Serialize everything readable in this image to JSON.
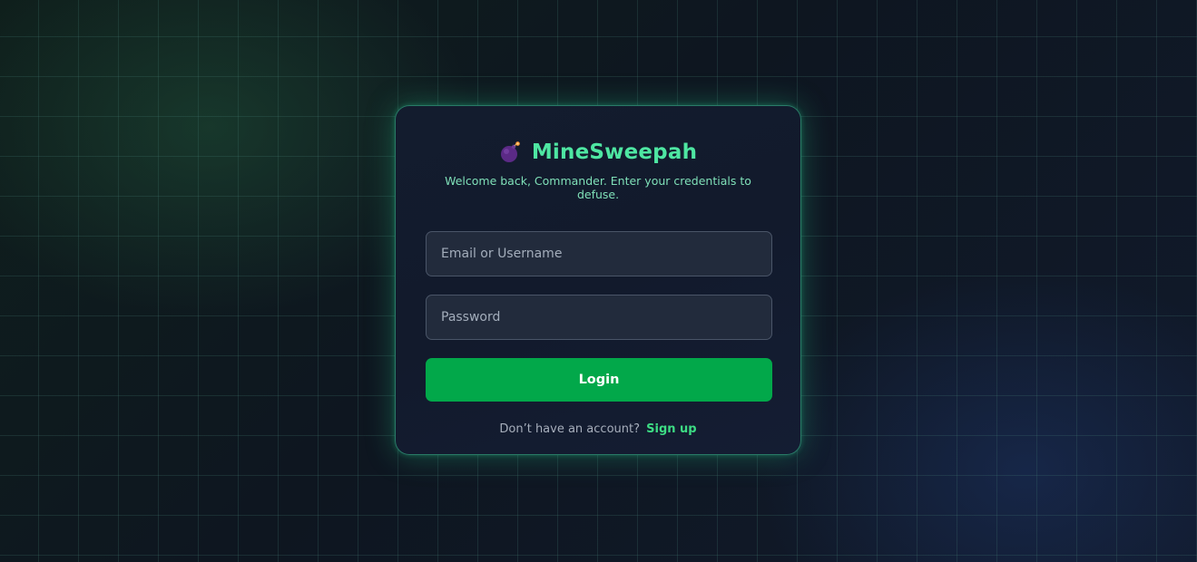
{
  "app": {
    "title": "MineSweepah",
    "logo_icon": "bomb-icon",
    "subtitle": "Welcome back, Commander. Enter your credentials to defuse."
  },
  "form": {
    "username": {
      "placeholder": "Email or Username",
      "value": ""
    },
    "password": {
      "placeholder": "Password",
      "value": ""
    },
    "login_label": "Login"
  },
  "footer": {
    "prompt": "Don’t have an account?",
    "signup_label": "Sign up"
  },
  "colors": {
    "accent": "#4ee6a2",
    "button": "#02a84a",
    "link": "#3ddc84",
    "card_border": "#3cc896",
    "background": "#0e1620"
  }
}
